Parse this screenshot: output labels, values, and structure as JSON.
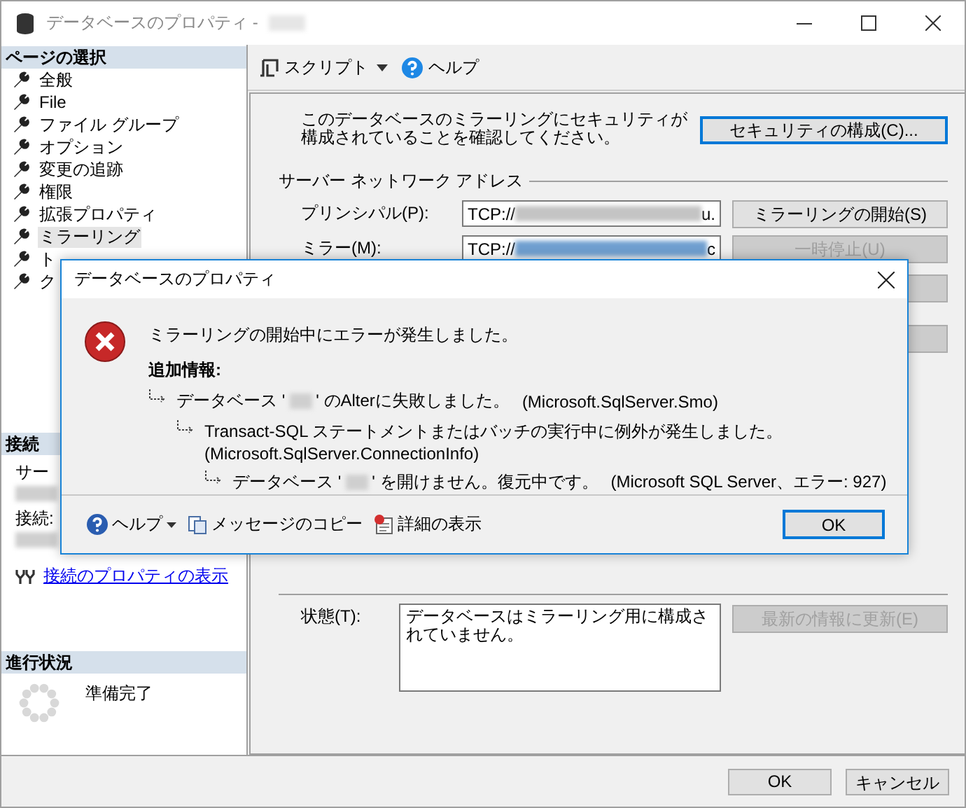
{
  "window": {
    "title": "データベースのプロパティ - "
  },
  "sidebar": {
    "header": "ページの選択",
    "items": [
      {
        "label": "全般",
        "selected": false
      },
      {
        "label": "File",
        "selected": false
      },
      {
        "label": "ファイル グループ",
        "selected": false
      },
      {
        "label": "オプション",
        "selected": false
      },
      {
        "label": "変更の追跡",
        "selected": false
      },
      {
        "label": "権限",
        "selected": false
      },
      {
        "label": "拡張プロパティ",
        "selected": false
      },
      {
        "label": "ミラーリング",
        "selected": true
      },
      {
        "label": "ト",
        "selected": false
      },
      {
        "label": "ク",
        "selected": false
      }
    ]
  },
  "connection": {
    "header": "接続",
    "labels": [
      "サー",
      "接続:"
    ],
    "link": "接続のプロパティの表示"
  },
  "progress": {
    "header": "進行状況",
    "status": "準備完了"
  },
  "toolbar": {
    "script": "スクリプト",
    "help": "ヘルプ"
  },
  "mirroring": {
    "intro": "このデータベースのミラーリングにセキュリティが構成されていることを確認してください。",
    "security_button": "セキュリティの構成(C)...",
    "section": "サーバー ネットワーク アドレス",
    "rows": [
      {
        "label": "プリンシパル(P):",
        "prefix": "TCP://",
        "suffix": "u.",
        "selected": false
      },
      {
        "label": "ミラー(M):",
        "prefix": "TCP://",
        "suffix": "c",
        "selected": true
      }
    ],
    "buttons": [
      {
        "label": "ミラーリングの開始(S)",
        "disabled": false
      },
      {
        "label": "一時停止(U)",
        "disabled": true
      },
      {
        "disabled": true
      },
      {
        "disabled": true
      }
    ],
    "status_label": "状態(T):",
    "status_value": "データベースはミラーリング用に構成されていません。",
    "refresh_button": {
      "label": "最新の情報に更新(E)",
      "disabled": true
    }
  },
  "footer_buttons": [
    "OK",
    "キャンセル"
  ],
  "dialog": {
    "title": "データベースのプロパティ",
    "message": "ミラーリングの開始中にエラーが発生しました。",
    "details_header": "追加情報:",
    "details": [
      {
        "before": "データベース '",
        "after": "' のAlterに失敗しました。",
        "source": "(Microsoft.SqlServer.Smo)",
        "children": [
          {
            "text": "Transact-SQL ステートメントまたはバッチの実行中に例外が発生しました。",
            "source": "(Microsoft.SqlServer.ConnectionInfo)",
            "children": [
              {
                "before": "データベース '",
                "after": "' を開けません。復元中です。",
                "source": "(Microsoft SQL Server、エラー: 927)"
              }
            ]
          }
        ]
      }
    ],
    "help": "ヘルプ",
    "copy": "メッセージのコピー",
    "details_button": "詳細の表示",
    "ok": "OK"
  }
}
